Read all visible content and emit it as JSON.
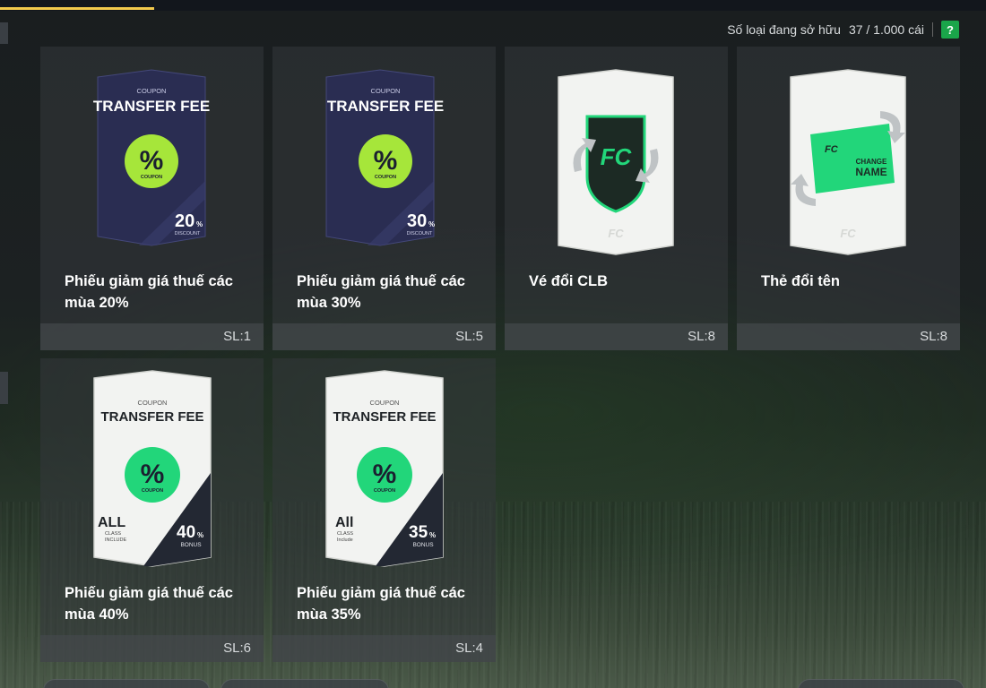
{
  "ownership": {
    "label": "Số loại đang sở hữu",
    "count": "37 / 1.000 cái",
    "help": "?"
  },
  "items": [
    {
      "name": "Phiếu giảm giá thuế các mùa 20%",
      "qty": "SL:1",
      "art": {
        "coupon": "COUPON",
        "title": "TRANSFER FEE",
        "badge": "%",
        "badge_sub": "COUPON",
        "value": "20",
        "value_unit": "%",
        "value_sub": "DISCOUNT"
      }
    },
    {
      "name": "Phiếu giảm giá thuế các mùa 30%",
      "qty": "SL:5",
      "art": {
        "coupon": "COUPON",
        "title": "TRANSFER FEE",
        "badge": "%",
        "badge_sub": "COUPON",
        "value": "30",
        "value_unit": "%",
        "value_sub": "DISCOUNT"
      }
    },
    {
      "name": "Vé đổi CLB",
      "qty": "SL:8",
      "art": {
        "icon": "club-change-icon"
      }
    },
    {
      "name": "Thẻ đổi tên",
      "qty": "SL:8",
      "art": {
        "ticket_line1": "CHANGE",
        "ticket_line2": "NAME",
        "icon": "name-change-icon"
      }
    },
    {
      "name": "Phiếu giảm giá thuế các mùa 40%",
      "qty": "SL:6",
      "art": {
        "coupon": "COUPON",
        "title": "TRANSFER FEE",
        "badge": "%",
        "badge_sub": "COUPON",
        "class_main": "ALL",
        "class_sub1": "CLASS",
        "class_sub2": "INCLUDE",
        "value": "40",
        "value_unit": "%",
        "value_sub": "BONUS"
      }
    },
    {
      "name": "Phiếu giảm giá thuế các mùa 35%",
      "qty": "SL:4",
      "art": {
        "coupon": "COUPON",
        "title": "TRANSFER FEE",
        "badge": "%",
        "badge_sub": "COUPON",
        "class_main": "All",
        "class_sub1": "CLASS",
        "class_sub2": "Include",
        "value": "35",
        "value_unit": "%",
        "value_sub": "BONUS"
      }
    }
  ],
  "colors": {
    "accent_green": "#1aa54a",
    "tab_underline": "#f2c94c",
    "lime_badge": "#a6e63a",
    "mint_badge": "#22d67a",
    "navy_card": "#2a2d52"
  }
}
